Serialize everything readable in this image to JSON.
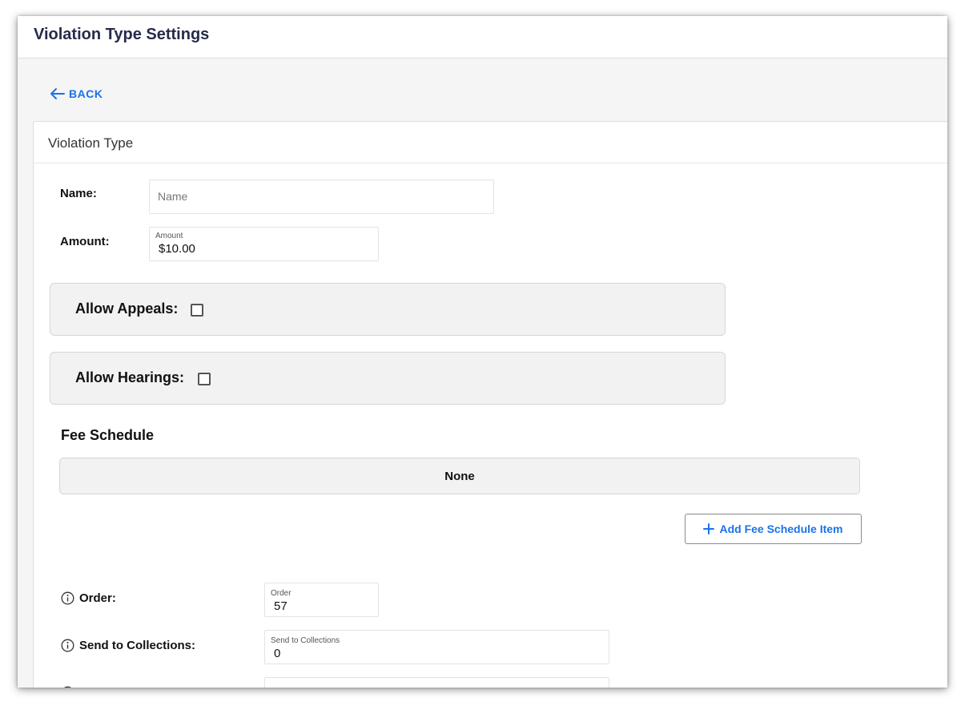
{
  "header": {
    "title": "Violation Type Settings"
  },
  "back": {
    "label": "BACK",
    "icon": "arrow-left-icon"
  },
  "card": {
    "title": "Violation Type"
  },
  "fields": {
    "name": {
      "label": "Name:",
      "placeholder": "Name"
    },
    "amount": {
      "label": "Amount:",
      "float_label": "Amount",
      "value": "$10.00"
    }
  },
  "toggles": {
    "appeals": {
      "label": "Allow Appeals:",
      "checked": false
    },
    "hearings": {
      "label": "Allow Hearings:",
      "checked": false
    }
  },
  "fee_schedule": {
    "title": "Fee Schedule",
    "empty_text": "None",
    "add_label": "Add Fee Schedule Item",
    "add_icon": "plus-icon"
  },
  "settings": {
    "order": {
      "label": "Order:",
      "float_label": "Order",
      "value": "57",
      "icon": "info-icon"
    },
    "collections": {
      "label": "Send to Collections:",
      "float_label": "Send to Collections",
      "value": "0",
      "icon": "info-icon"
    }
  },
  "colors": {
    "accent": "#1a73e8",
    "header_text": "#262b4a",
    "panel_bg": "#f2f2f2"
  }
}
